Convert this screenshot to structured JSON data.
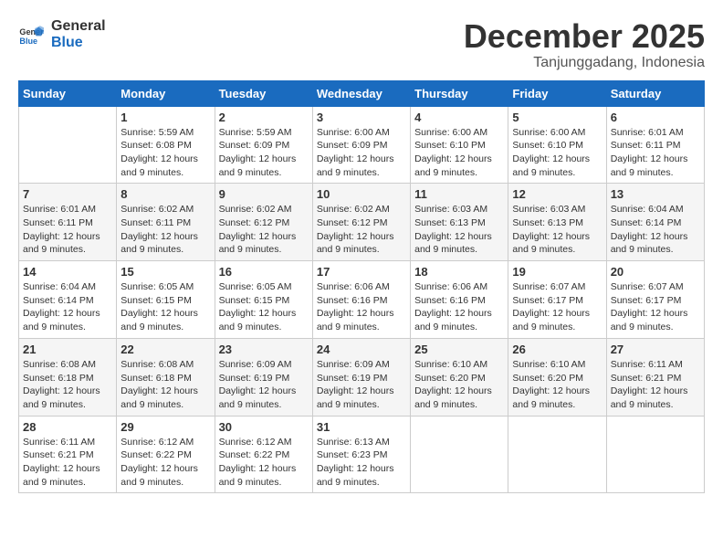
{
  "header": {
    "logo_line1": "General",
    "logo_line2": "Blue",
    "month_year": "December 2025",
    "location": "Tanjunggadang, Indonesia"
  },
  "weekdays": [
    "Sunday",
    "Monday",
    "Tuesday",
    "Wednesday",
    "Thursday",
    "Friday",
    "Saturday"
  ],
  "weeks": [
    [
      {
        "day": "",
        "sunrise": "",
        "sunset": "",
        "daylight": ""
      },
      {
        "day": "1",
        "sunrise": "Sunrise: 5:59 AM",
        "sunset": "Sunset: 6:08 PM",
        "daylight": "Daylight: 12 hours and 9 minutes."
      },
      {
        "day": "2",
        "sunrise": "Sunrise: 5:59 AM",
        "sunset": "Sunset: 6:09 PM",
        "daylight": "Daylight: 12 hours and 9 minutes."
      },
      {
        "day": "3",
        "sunrise": "Sunrise: 6:00 AM",
        "sunset": "Sunset: 6:09 PM",
        "daylight": "Daylight: 12 hours and 9 minutes."
      },
      {
        "day": "4",
        "sunrise": "Sunrise: 6:00 AM",
        "sunset": "Sunset: 6:10 PM",
        "daylight": "Daylight: 12 hours and 9 minutes."
      },
      {
        "day": "5",
        "sunrise": "Sunrise: 6:00 AM",
        "sunset": "Sunset: 6:10 PM",
        "daylight": "Daylight: 12 hours and 9 minutes."
      },
      {
        "day": "6",
        "sunrise": "Sunrise: 6:01 AM",
        "sunset": "Sunset: 6:11 PM",
        "daylight": "Daylight: 12 hours and 9 minutes."
      }
    ],
    [
      {
        "day": "7",
        "sunrise": "Sunrise: 6:01 AM",
        "sunset": "Sunset: 6:11 PM",
        "daylight": "Daylight: 12 hours and 9 minutes."
      },
      {
        "day": "8",
        "sunrise": "Sunrise: 6:02 AM",
        "sunset": "Sunset: 6:11 PM",
        "daylight": "Daylight: 12 hours and 9 minutes."
      },
      {
        "day": "9",
        "sunrise": "Sunrise: 6:02 AM",
        "sunset": "Sunset: 6:12 PM",
        "daylight": "Daylight: 12 hours and 9 minutes."
      },
      {
        "day": "10",
        "sunrise": "Sunrise: 6:02 AM",
        "sunset": "Sunset: 6:12 PM",
        "daylight": "Daylight: 12 hours and 9 minutes."
      },
      {
        "day": "11",
        "sunrise": "Sunrise: 6:03 AM",
        "sunset": "Sunset: 6:13 PM",
        "daylight": "Daylight: 12 hours and 9 minutes."
      },
      {
        "day": "12",
        "sunrise": "Sunrise: 6:03 AM",
        "sunset": "Sunset: 6:13 PM",
        "daylight": "Daylight: 12 hours and 9 minutes."
      },
      {
        "day": "13",
        "sunrise": "Sunrise: 6:04 AM",
        "sunset": "Sunset: 6:14 PM",
        "daylight": "Daylight: 12 hours and 9 minutes."
      }
    ],
    [
      {
        "day": "14",
        "sunrise": "Sunrise: 6:04 AM",
        "sunset": "Sunset: 6:14 PM",
        "daylight": "Daylight: 12 hours and 9 minutes."
      },
      {
        "day": "15",
        "sunrise": "Sunrise: 6:05 AM",
        "sunset": "Sunset: 6:15 PM",
        "daylight": "Daylight: 12 hours and 9 minutes."
      },
      {
        "day": "16",
        "sunrise": "Sunrise: 6:05 AM",
        "sunset": "Sunset: 6:15 PM",
        "daylight": "Daylight: 12 hours and 9 minutes."
      },
      {
        "day": "17",
        "sunrise": "Sunrise: 6:06 AM",
        "sunset": "Sunset: 6:16 PM",
        "daylight": "Daylight: 12 hours and 9 minutes."
      },
      {
        "day": "18",
        "sunrise": "Sunrise: 6:06 AM",
        "sunset": "Sunset: 6:16 PM",
        "daylight": "Daylight: 12 hours and 9 minutes."
      },
      {
        "day": "19",
        "sunrise": "Sunrise: 6:07 AM",
        "sunset": "Sunset: 6:17 PM",
        "daylight": "Daylight: 12 hours and 9 minutes."
      },
      {
        "day": "20",
        "sunrise": "Sunrise: 6:07 AM",
        "sunset": "Sunset: 6:17 PM",
        "daylight": "Daylight: 12 hours and 9 minutes."
      }
    ],
    [
      {
        "day": "21",
        "sunrise": "Sunrise: 6:08 AM",
        "sunset": "Sunset: 6:18 PM",
        "daylight": "Daylight: 12 hours and 9 minutes."
      },
      {
        "day": "22",
        "sunrise": "Sunrise: 6:08 AM",
        "sunset": "Sunset: 6:18 PM",
        "daylight": "Daylight: 12 hours and 9 minutes."
      },
      {
        "day": "23",
        "sunrise": "Sunrise: 6:09 AM",
        "sunset": "Sunset: 6:19 PM",
        "daylight": "Daylight: 12 hours and 9 minutes."
      },
      {
        "day": "24",
        "sunrise": "Sunrise: 6:09 AM",
        "sunset": "Sunset: 6:19 PM",
        "daylight": "Daylight: 12 hours and 9 minutes."
      },
      {
        "day": "25",
        "sunrise": "Sunrise: 6:10 AM",
        "sunset": "Sunset: 6:20 PM",
        "daylight": "Daylight: 12 hours and 9 minutes."
      },
      {
        "day": "26",
        "sunrise": "Sunrise: 6:10 AM",
        "sunset": "Sunset: 6:20 PM",
        "daylight": "Daylight: 12 hours and 9 minutes."
      },
      {
        "day": "27",
        "sunrise": "Sunrise: 6:11 AM",
        "sunset": "Sunset: 6:21 PM",
        "daylight": "Daylight: 12 hours and 9 minutes."
      }
    ],
    [
      {
        "day": "28",
        "sunrise": "Sunrise: 6:11 AM",
        "sunset": "Sunset: 6:21 PM",
        "daylight": "Daylight: 12 hours and 9 minutes."
      },
      {
        "day": "29",
        "sunrise": "Sunrise: 6:12 AM",
        "sunset": "Sunset: 6:22 PM",
        "daylight": "Daylight: 12 hours and 9 minutes."
      },
      {
        "day": "30",
        "sunrise": "Sunrise: 6:12 AM",
        "sunset": "Sunset: 6:22 PM",
        "daylight": "Daylight: 12 hours and 9 minutes."
      },
      {
        "day": "31",
        "sunrise": "Sunrise: 6:13 AM",
        "sunset": "Sunset: 6:23 PM",
        "daylight": "Daylight: 12 hours and 9 minutes."
      },
      {
        "day": "",
        "sunrise": "",
        "sunset": "",
        "daylight": ""
      },
      {
        "day": "",
        "sunrise": "",
        "sunset": "",
        "daylight": ""
      },
      {
        "day": "",
        "sunrise": "",
        "sunset": "",
        "daylight": ""
      }
    ]
  ]
}
